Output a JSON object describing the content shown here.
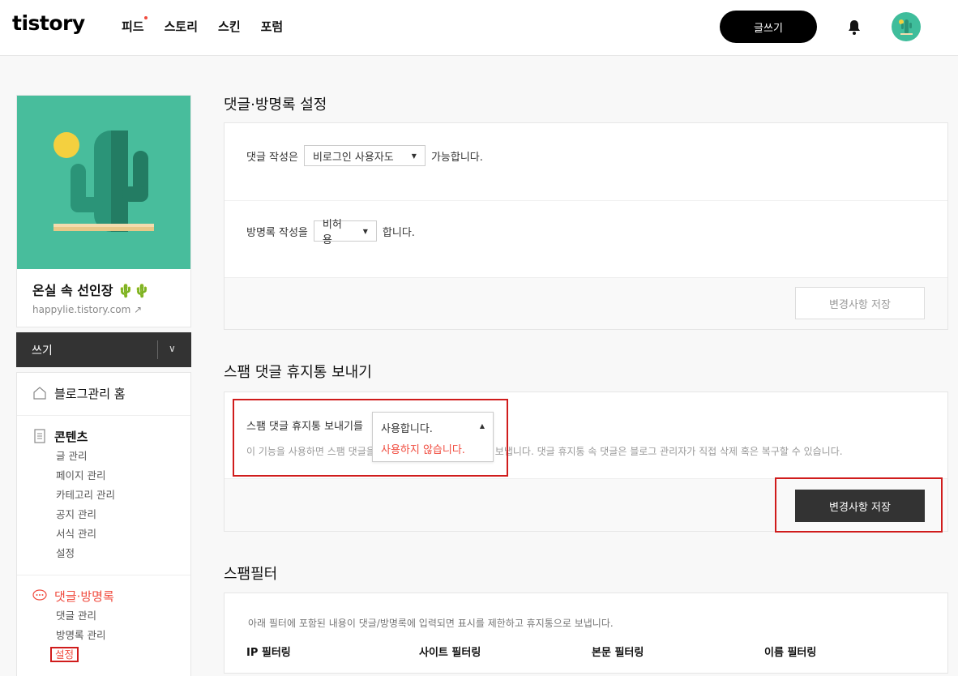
{
  "header": {
    "logo": "tistory",
    "nav": [
      "피드",
      "스토리",
      "스킨",
      "포럼"
    ],
    "write_button": "글쓰기"
  },
  "sidebar": {
    "blog_name": "온실 속 선인장 🌵🌵",
    "blog_url": "happylie.tistory.com",
    "write_label": "쓰기",
    "home_label": "블로그관리 홈",
    "contents": {
      "title": "콘텐츠",
      "items": [
        "글 관리",
        "페이지 관리",
        "카테고리 관리",
        "공지 관리",
        "서식 관리",
        "설정"
      ]
    },
    "comments": {
      "title": "댓글·방명록",
      "items": [
        "댓글 관리",
        "방명록 관리",
        "설정"
      ]
    }
  },
  "main": {
    "section1": {
      "title": "댓글·방명록 설정",
      "comment_prefix": "댓글 작성은",
      "comment_select": "비로그인 사용자도",
      "comment_suffix": "가능합니다.",
      "guestbook_prefix": "방명록 작성을",
      "guestbook_select": "비허용",
      "guestbook_suffix": "합니다.",
      "save": "변경사항 저장"
    },
    "section2": {
      "title": "스팸 댓글 휴지통 보내기",
      "label": "스팸 댓글 휴지통 보내기를",
      "dropdown_selected": "사용합니다.",
      "dropdown_option": "사용하지 않습니다.",
      "help_visible_left": "이 기능을 사용하면 스팸 댓글을",
      "help_visible_right": "보냅니다. 댓글 휴지통 속 댓글은 블로그 관리자가 직접 삭제 혹은 복구할 수 있습니다.",
      "save": "변경사항 저장"
    },
    "section3": {
      "title": "스팸필터",
      "desc": "아래 필터에 포함된 내용이 댓글/방명록에 입력되면 표시를 제한하고 휴지통으로 보냅니다.",
      "filters": [
        "IP 필터링",
        "사이트 필터링",
        "본문 필터링",
        "이름 필터링"
      ]
    }
  },
  "colors": {
    "accent": "#f04b3e",
    "highlight_box": "#d01c1c",
    "dark_button": "#333333",
    "blog_bg": "#48bd9c"
  }
}
